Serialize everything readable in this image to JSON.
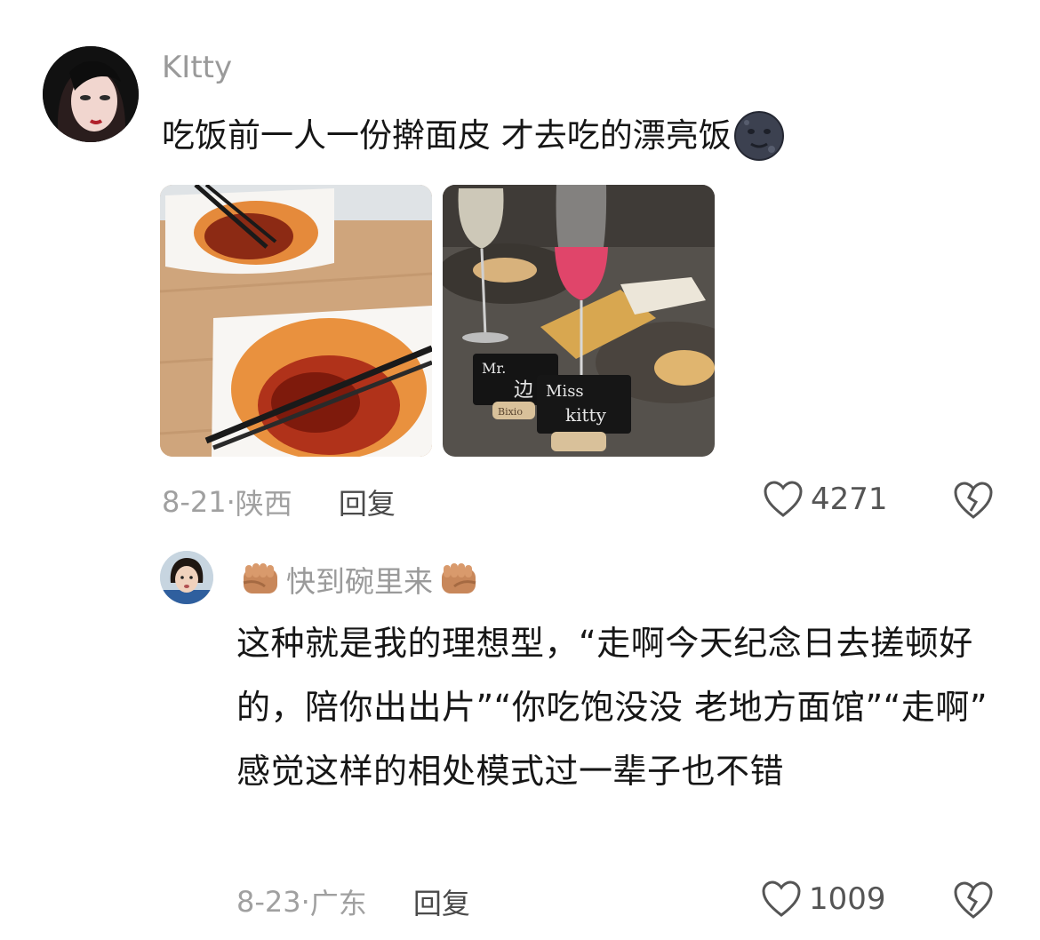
{
  "comments": [
    {
      "username": "KItty",
      "text": "吃饭前一人一份擀面皮 才去吃的漂亮饭",
      "emoji": "new-moon-face",
      "photos": [
        "spicy-noodle-bowls-photo",
        "restaurant-wine-table-photo"
      ],
      "photo_text": {
        "card_1": "Mr.",
        "card_1_name": "边",
        "card_2": "Miss",
        "card_2_name": "kitty",
        "cork": "Bixio"
      },
      "date": "8-21",
      "location": "陕西",
      "reply_label": "回复",
      "likes": "4271"
    },
    {
      "username": "快到碗里来",
      "username_emoji": "fist-icon",
      "text": "这种就是我的理想型，“走啊今天纪念日去搓顿好的，陪你出出片”“你吃饱没没 老地方面馆”“走啊” 感觉这样的相处模式过一辈子也不错",
      "date": "8-23",
      "location": "广东",
      "reply_label": "回复",
      "likes": "1009"
    }
  ],
  "colors": {
    "meta_gray": "#a0a0a0",
    "text_dark": "#161616",
    "username_gray": "#9a9a9a"
  }
}
